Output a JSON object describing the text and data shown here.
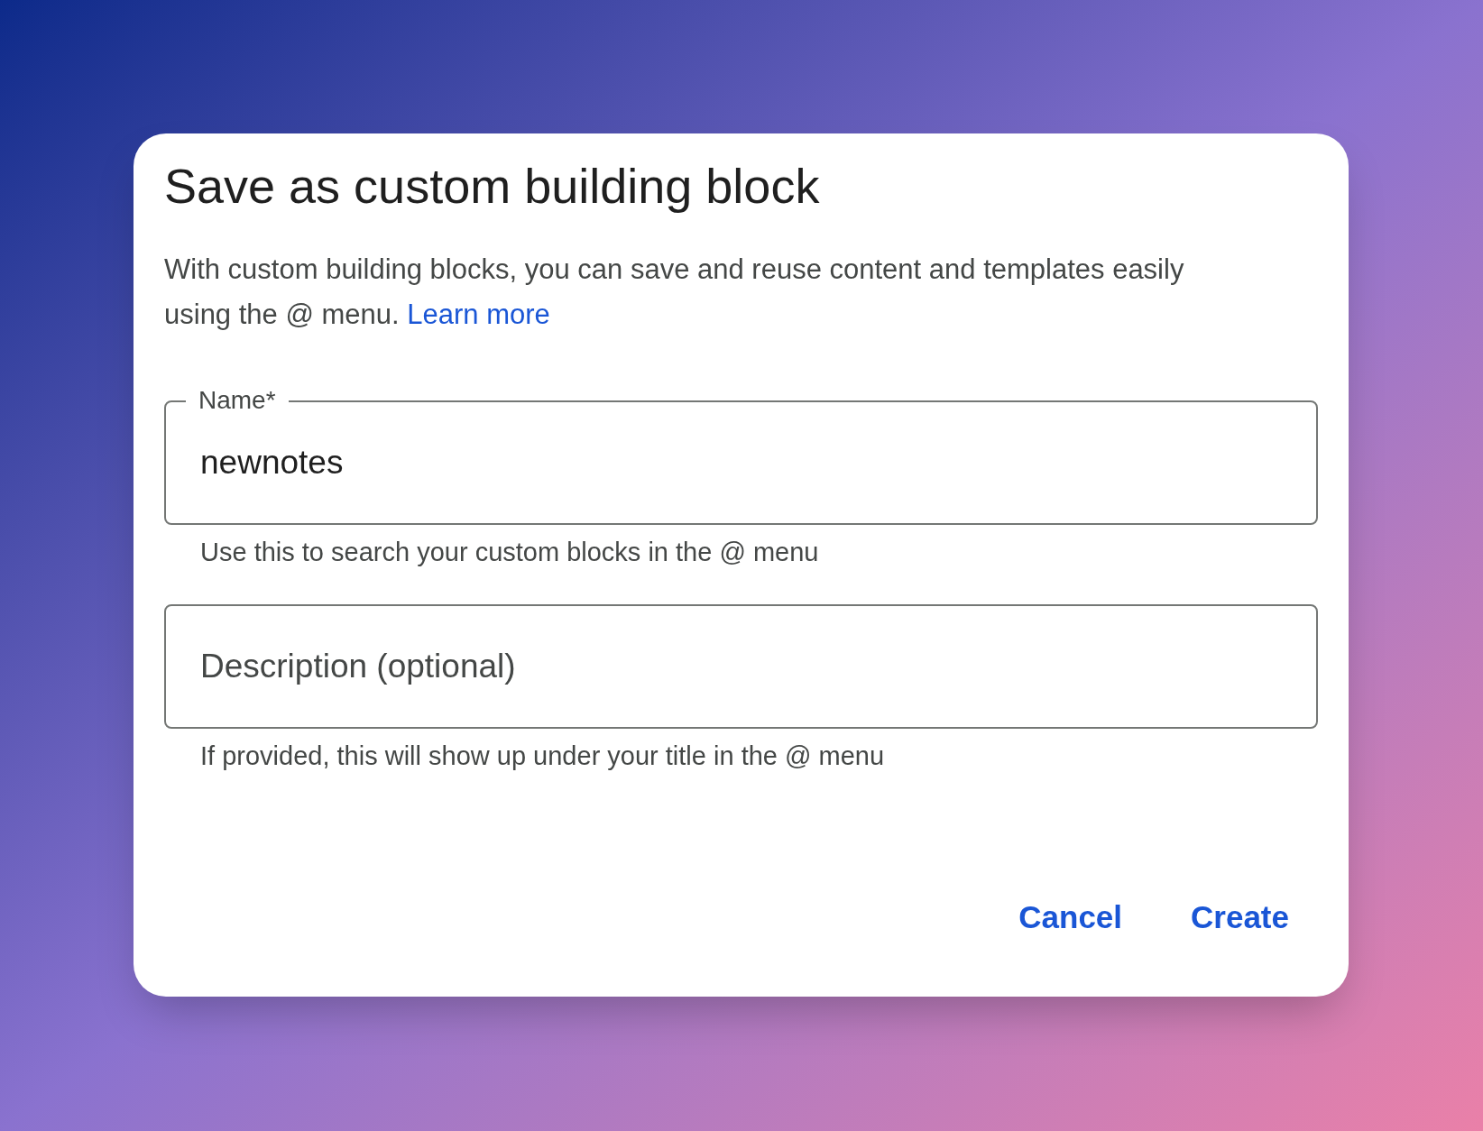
{
  "dialog": {
    "title": "Save as custom building block",
    "description": "With custom building blocks, you can save and reuse content and templates easily using the @ menu.",
    "link": "Learn more",
    "fields": [
      {
        "label": "Name*",
        "value": "newnotes",
        "helper": "Use this to search your custom blocks in the @ menu"
      },
      {
        "placeholder": "Description (optional)",
        "helper": "If provided, this will show up under your title in the @ menu"
      }
    ],
    "buttons": [
      "Cancel",
      "Create"
    ]
  }
}
